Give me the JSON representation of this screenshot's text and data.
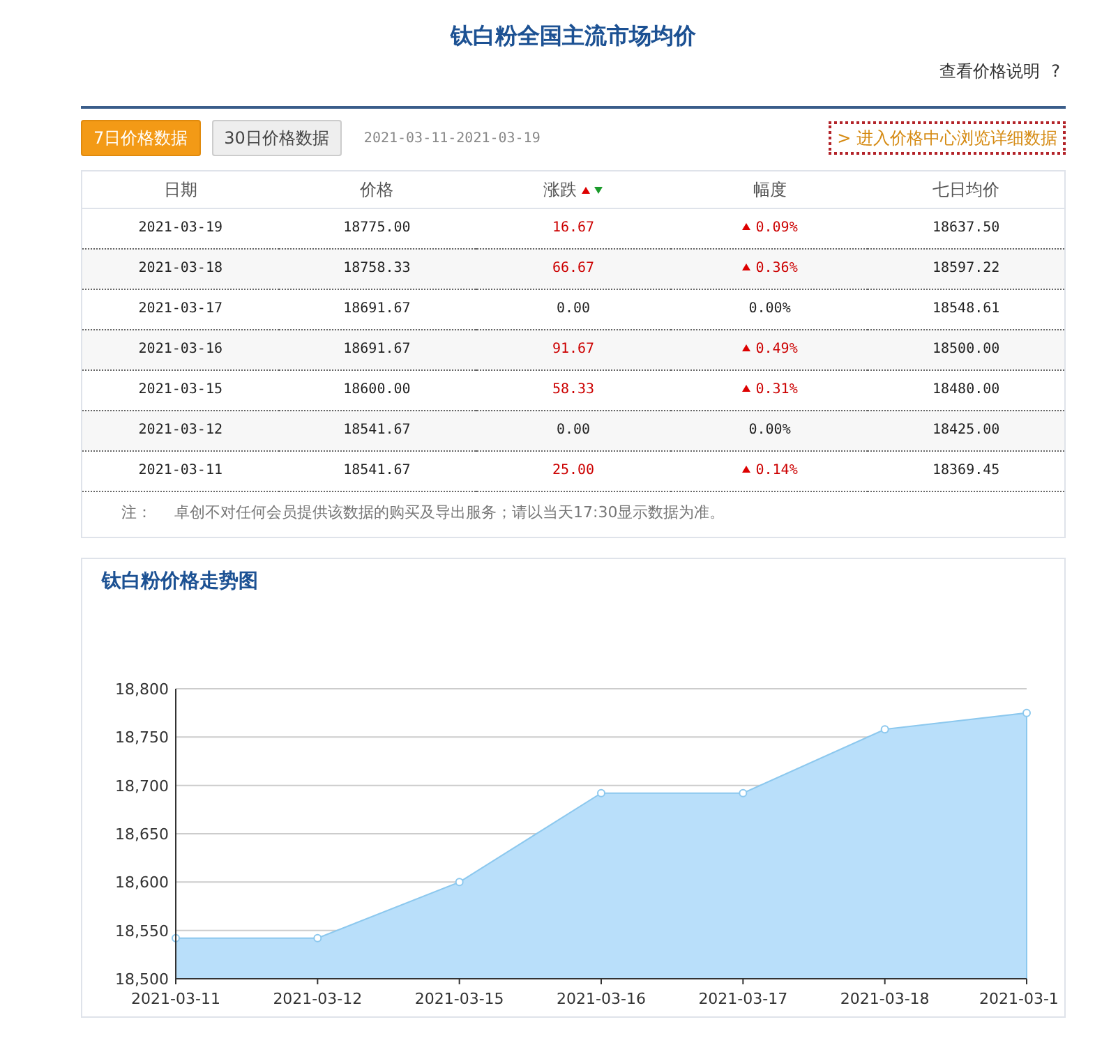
{
  "title": "钛白粉全国主流市场均价",
  "price_note_link": "查看价格说明",
  "help_mark": "?",
  "tabs": [
    {
      "label": "7日价格数据",
      "selected": true
    },
    {
      "label": "30日价格数据",
      "selected": false
    }
  ],
  "date_range": "2021-03-11-2021-03-19",
  "detail_link": "进入价格中心浏览详细数据",
  "detail_link_mark": ">",
  "table": {
    "columns": [
      "日期",
      "价格",
      "涨跌",
      "幅度",
      "七日均价"
    ],
    "rows": [
      {
        "date": "2021-03-19",
        "price": "18775.00",
        "change": "16.67",
        "pct": "0.09%",
        "avg": "18637.50",
        "rising": true
      },
      {
        "date": "2021-03-18",
        "price": "18758.33",
        "change": "66.67",
        "pct": "0.36%",
        "avg": "18597.22",
        "rising": true
      },
      {
        "date": "2021-03-17",
        "price": "18691.67",
        "change": "0.00",
        "pct": "0.00%",
        "avg": "18548.61",
        "rising": false
      },
      {
        "date": "2021-03-16",
        "price": "18691.67",
        "change": "91.67",
        "pct": "0.49%",
        "avg": "18500.00",
        "rising": true
      },
      {
        "date": "2021-03-15",
        "price": "18600.00",
        "change": "58.33",
        "pct": "0.31%",
        "avg": "18480.00",
        "rising": true
      },
      {
        "date": "2021-03-12",
        "price": "18541.67",
        "change": "0.00",
        "pct": "0.00%",
        "avg": "18425.00",
        "rising": false
      },
      {
        "date": "2021-03-11",
        "price": "18541.67",
        "change": "25.00",
        "pct": "0.14%",
        "avg": "18369.45",
        "rising": true
      }
    ]
  },
  "note_label": "注：",
  "note": "卓创不对任何会员提供该数据的购买及导出服务；请以当天17:30显示数据为准。",
  "chart_panel": {
    "title": "钛白粉价格走势图",
    "chart_data": {
      "type": "area",
      "categories": [
        "2021-03-11",
        "2021-03-12",
        "2021-03-15",
        "2021-03-16",
        "2021-03-17",
        "2021-03-18",
        "2021-03-1"
      ],
      "values": [
        18542,
        18542,
        18600,
        18692,
        18692,
        18758,
        18775
      ],
      "grid": true,
      "ylim": [
        18500,
        18800
      ],
      "yticks": [
        {
          "value": 18500,
          "label": "18,500"
        },
        {
          "value": 18550,
          "label": "18,550"
        },
        {
          "value": 18600,
          "label": "18,600"
        },
        {
          "value": 18650,
          "label": "18,650"
        },
        {
          "value": 18700,
          "label": "18,700"
        },
        {
          "value": 18750,
          "label": "18,750"
        },
        {
          "value": 18800,
          "label": "18,800"
        }
      ]
    }
  }
}
